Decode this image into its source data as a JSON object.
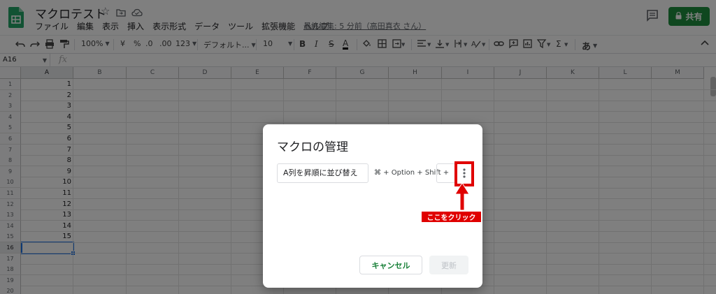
{
  "header": {
    "title": "マクロテスト",
    "menu": [
      "ファイル",
      "編集",
      "表示",
      "挿入",
      "表示形式",
      "データ",
      "ツール",
      "拡張機能",
      "ヘルプ"
    ],
    "last_edit": "最終編集: 5 分前（高田真衣 さん）",
    "share_label": "共有"
  },
  "toolbar": {
    "zoom": "100%",
    "currency": "¥",
    "percent": "%",
    "decimal_decrease": ".0",
    "decimal_increase": ".00",
    "number_format": "123",
    "font": "デフォルト...",
    "font_size": "10",
    "bold": "B",
    "italic": "I",
    "strikethrough": "S",
    "text_color": "A",
    "input_tools": "あ"
  },
  "formula_bar": {
    "cell_ref": "A16",
    "fx": "fx"
  },
  "grid": {
    "columns": [
      "A",
      "B",
      "C",
      "D",
      "E",
      "F",
      "G",
      "H",
      "I",
      "J",
      "K",
      "L",
      "M"
    ],
    "rows": [
      "1",
      "2",
      "3",
      "4",
      "5",
      "6",
      "7",
      "8",
      "9",
      "10",
      "11",
      "12",
      "13",
      "14",
      "15",
      "16",
      "17",
      "18",
      "19",
      "20"
    ],
    "column_a_values": [
      "1",
      "2",
      "3",
      "4",
      "5",
      "6",
      "7",
      "8",
      "9",
      "10",
      "11",
      "12",
      "13",
      "14",
      "15"
    ],
    "selected_cell": "A16"
  },
  "dialog": {
    "title": "マクロの管理",
    "macro_name": "A列を昇順に並び替え",
    "shortcut_label": "⌘ + Option + Shift +",
    "shortcut_key": "",
    "cancel_label": "キャンセル",
    "update_label": "更新"
  },
  "annotation": {
    "label": "ここをクリック",
    "color": "#e00000"
  },
  "colors": {
    "accent": "#1e8e3e",
    "selection": "#1a73e8"
  }
}
